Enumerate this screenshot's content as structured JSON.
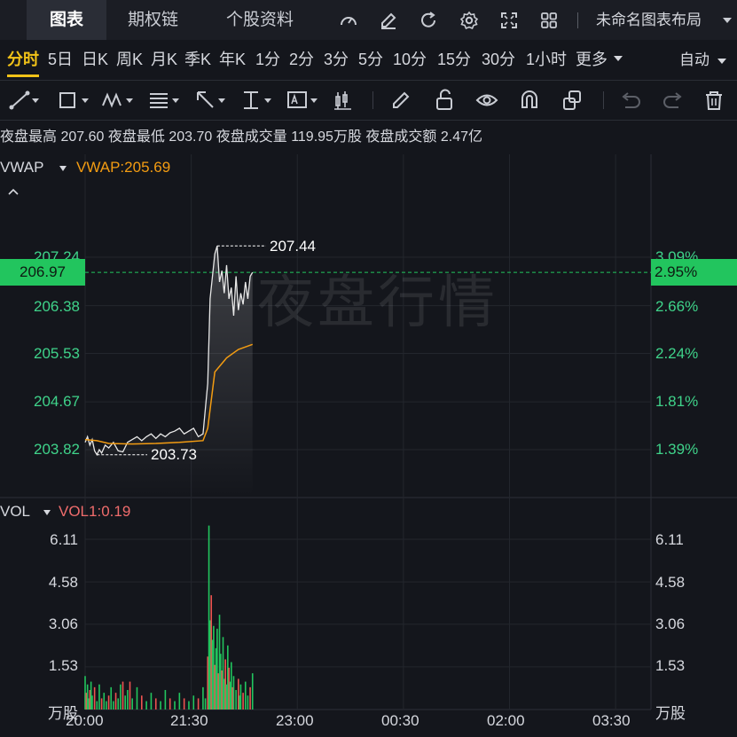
{
  "top_tabs": {
    "tab1": "图表",
    "tab2": "期权链",
    "tab3": "个股资料",
    "layout_name": "未命名图表布局"
  },
  "periods": [
    "分时",
    "5日",
    "日K",
    "周K",
    "月K",
    "季K",
    "年K",
    "1分",
    "2分",
    "3分",
    "5分",
    "10分",
    "15分",
    "30分",
    "1小时",
    "更多"
  ],
  "period_active": "分时",
  "auto_label": "自动",
  "info": {
    "night_high_label": "夜盘最高",
    "night_high": "207.60",
    "night_low_label": "夜盘最低",
    "night_low": "203.70",
    "night_volume_label": "夜盘成交量",
    "night_volume": "119.95万股",
    "night_amount_label": "夜盘成交额",
    "night_amount": "2.47亿"
  },
  "indicator": {
    "name": "VWAP",
    "value_label": "VWAP:205.69"
  },
  "price_axis": {
    "left_labels": [
      "207.24",
      "206.38",
      "205.53",
      "204.67",
      "203.82"
    ],
    "right_labels": [
      "3.09%",
      "2.66%",
      "2.24%",
      "1.81%",
      "1.39%"
    ],
    "current_price": "206.97",
    "current_pct": "2.95%"
  },
  "annotations": {
    "high": "207.44",
    "low": "203.73"
  },
  "watermark": "夜盘行情",
  "volume": {
    "name": "VOL",
    "value_label": "VOL1:0.19",
    "axis_labels": [
      "6.11",
      "4.58",
      "3.06",
      "1.53"
    ],
    "unit": "万股"
  },
  "x_axis": [
    "20:00",
    "21:30",
    "23:00",
    "00:30",
    "02:00",
    "03:30"
  ],
  "colors": {
    "accent": "#f2c318",
    "up": "#22c55e",
    "down": "#ef5350",
    "vwap": "#f39c12",
    "price_line": "#e8e8e8"
  },
  "chart_data": {
    "type": "line",
    "x_range": [
      "20:00",
      "04:00"
    ],
    "ylim": [
      203.3,
      207.8
    ],
    "price_series": [
      [
        "20:00",
        203.95
      ],
      [
        "20:02",
        204.05
      ],
      [
        "20:04",
        203.9
      ],
      [
        "20:06",
        204.0
      ],
      [
        "20:08",
        203.8
      ],
      [
        "20:10",
        203.73
      ],
      [
        "20:12",
        203.82
      ],
      [
        "20:14",
        203.76
      ],
      [
        "20:17",
        203.9
      ],
      [
        "20:20",
        203.85
      ],
      [
        "20:24",
        203.95
      ],
      [
        "20:28",
        203.8
      ],
      [
        "20:32",
        203.78
      ],
      [
        "20:36",
        203.95
      ],
      [
        "20:40",
        204.0
      ],
      [
        "20:44",
        204.05
      ],
      [
        "20:48",
        203.98
      ],
      [
        "20:52",
        204.05
      ],
      [
        "20:56",
        204.1
      ],
      [
        "21:00",
        204.02
      ],
      [
        "21:04",
        204.1
      ],
      [
        "21:08",
        204.05
      ],
      [
        "21:12",
        204.12
      ],
      [
        "21:16",
        204.15
      ],
      [
        "21:20",
        204.2
      ],
      [
        "21:24",
        204.1
      ],
      [
        "21:28",
        204.15
      ],
      [
        "21:32",
        204.2
      ],
      [
        "21:36",
        204.05
      ],
      [
        "21:40",
        204.1
      ],
      [
        "21:44",
        205.0
      ],
      [
        "21:46",
        206.5
      ],
      [
        "21:48",
        206.9
      ],
      [
        "21:50",
        207.3
      ],
      [
        "21:52",
        207.44
      ],
      [
        "21:54",
        206.8
      ],
      [
        "21:56",
        207.0
      ],
      [
        "21:58",
        206.6
      ],
      [
        "22:00",
        207.1
      ],
      [
        "22:02",
        206.5
      ],
      [
        "22:04",
        206.7
      ],
      [
        "22:06",
        206.2
      ],
      [
        "22:08",
        206.9
      ],
      [
        "22:10",
        206.3
      ],
      [
        "22:12",
        206.6
      ],
      [
        "22:14",
        206.4
      ],
      [
        "22:16",
        206.8
      ],
      [
        "22:18",
        206.5
      ],
      [
        "22:20",
        206.9
      ],
      [
        "22:22",
        206.97
      ]
    ],
    "vwap_series": [
      [
        "20:00",
        204.0
      ],
      [
        "20:10",
        203.98
      ],
      [
        "20:20",
        203.93
      ],
      [
        "20:40",
        203.92
      ],
      [
        "21:00",
        203.93
      ],
      [
        "21:20",
        203.95
      ],
      [
        "21:40",
        203.98
      ],
      [
        "21:44",
        204.2
      ],
      [
        "21:50",
        205.2
      ],
      [
        "22:00",
        205.45
      ],
      [
        "22:10",
        205.6
      ],
      [
        "22:22",
        205.69
      ]
    ],
    "volume_bars": [
      [
        "20:00",
        1.2
      ],
      [
        "20:01",
        0.6
      ],
      [
        "20:02",
        0.9
      ],
      [
        "20:03",
        0.4
      ],
      [
        "20:04",
        0.7
      ],
      [
        "20:05",
        1.0
      ],
      [
        "20:06",
        0.5
      ],
      [
        "20:08",
        0.8
      ],
      [
        "20:10",
        0.3
      ],
      [
        "20:12",
        0.9
      ],
      [
        "20:14",
        0.4
      ],
      [
        "20:16",
        0.6
      ],
      [
        "20:18",
        0.3
      ],
      [
        "20:20",
        0.5
      ],
      [
        "20:22",
        0.8
      ],
      [
        "20:24",
        0.3
      ],
      [
        "20:26",
        0.6
      ],
      [
        "20:28",
        0.4
      ],
      [
        "20:30",
        0.9
      ],
      [
        "20:32",
        1.0
      ],
      [
        "20:34",
        0.5
      ],
      [
        "20:36",
        0.7
      ],
      [
        "20:38",
        1.0
      ],
      [
        "20:40",
        0.4
      ],
      [
        "20:44",
        0.8
      ],
      [
        "20:48",
        0.5
      ],
      [
        "20:52",
        0.3
      ],
      [
        "20:56",
        0.6
      ],
      [
        "21:00",
        0.4
      ],
      [
        "21:04",
        0.3
      ],
      [
        "21:08",
        0.7
      ],
      [
        "21:12",
        0.4
      ],
      [
        "21:16",
        0.3
      ],
      [
        "21:20",
        0.6
      ],
      [
        "21:24",
        0.4
      ],
      [
        "21:28",
        0.3
      ],
      [
        "21:32",
        0.5
      ],
      [
        "21:36",
        0.4
      ],
      [
        "21:40",
        0.8
      ],
      [
        "21:42",
        0.4
      ],
      [
        "21:44",
        1.9
      ],
      [
        "21:45",
        6.6
      ],
      [
        "21:46",
        3.2
      ],
      [
        "21:47",
        4.1
      ],
      [
        "21:48",
        2.5
      ],
      [
        "21:49",
        3.0
      ],
      [
        "21:50",
        1.6
      ],
      [
        "21:51",
        2.2
      ],
      [
        "21:52",
        2.9
      ],
      [
        "21:53",
        1.3
      ],
      [
        "21:54",
        3.4
      ],
      [
        "21:55",
        2.0
      ],
      [
        "21:56",
        1.4
      ],
      [
        "21:57",
        2.6
      ],
      [
        "21:58",
        1.1
      ],
      [
        "21:59",
        1.8
      ],
      [
        "22:00",
        0.9
      ],
      [
        "22:01",
        2.3
      ],
      [
        "22:02",
        1.5
      ],
      [
        "22:03",
        1.0
      ],
      [
        "22:04",
        1.7
      ],
      [
        "22:05",
        0.8
      ],
      [
        "22:06",
        1.2
      ],
      [
        "22:08",
        0.7
      ],
      [
        "22:10",
        1.1
      ],
      [
        "22:11",
        0.5
      ],
      [
        "22:12",
        0.9
      ],
      [
        "22:14",
        0.6
      ],
      [
        "22:16",
        1.0
      ],
      [
        "22:18",
        0.5
      ],
      [
        "22:20",
        0.8
      ],
      [
        "22:22",
        1.3
      ]
    ],
    "volume_ylim": [
      0,
      6.9
    ]
  }
}
